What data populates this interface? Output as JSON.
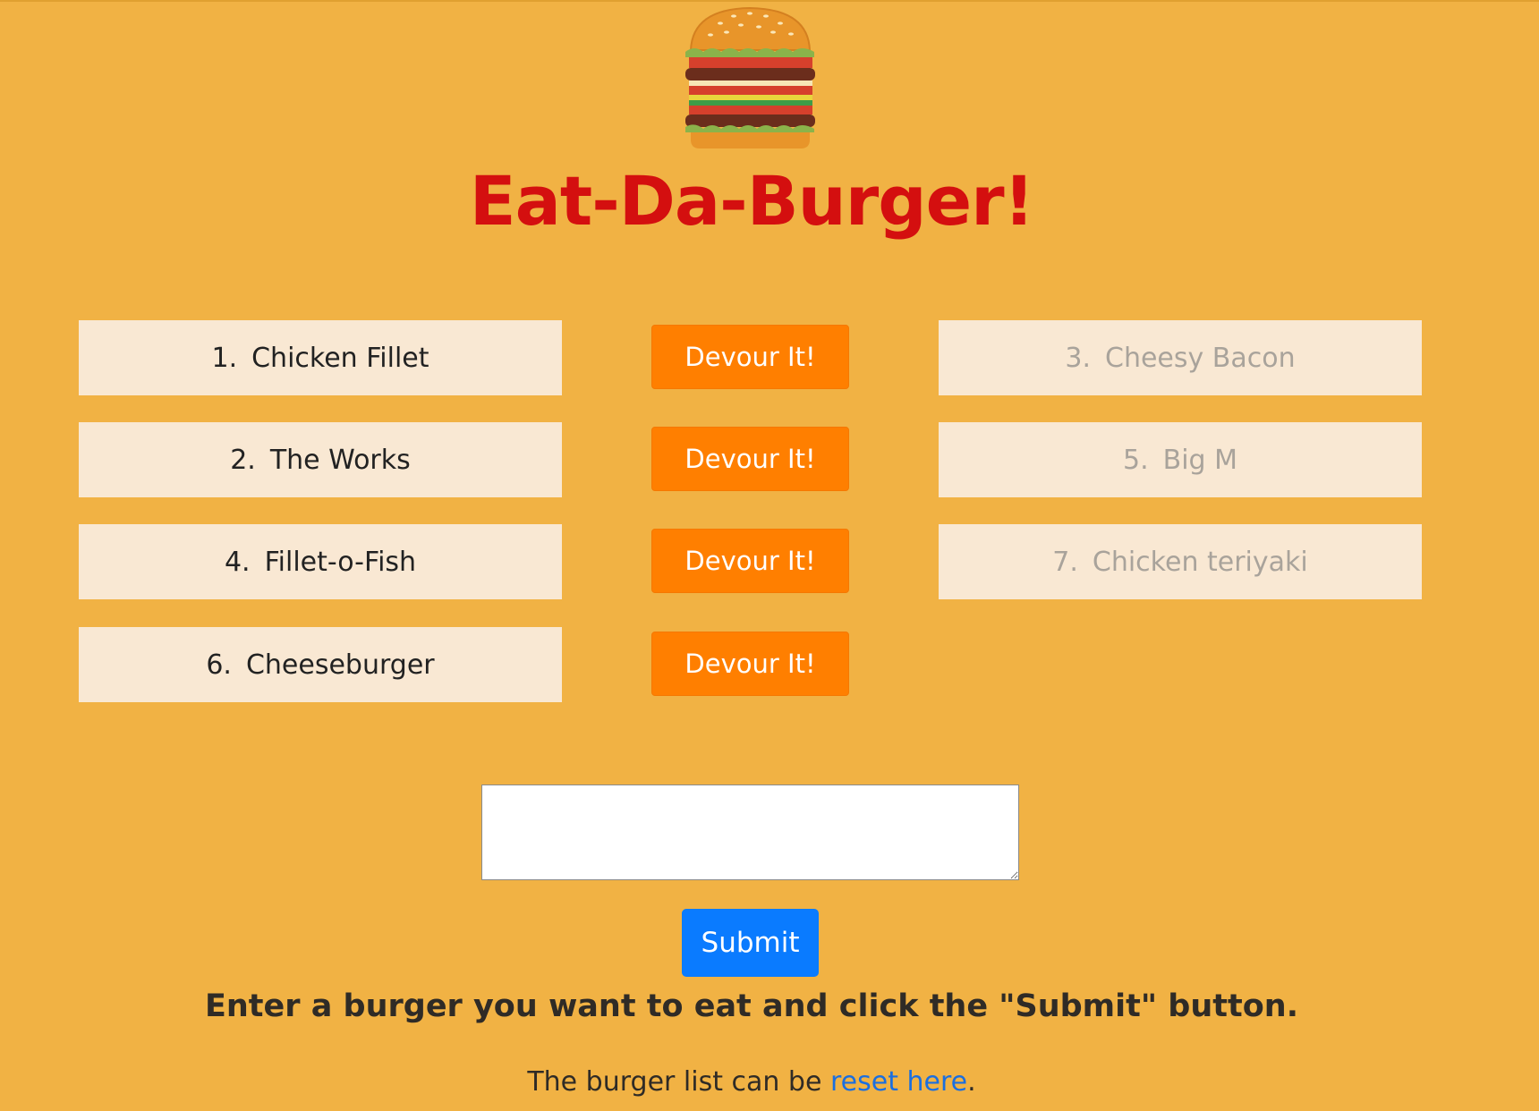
{
  "header": {
    "logo_icon": "burger-icon",
    "title": "Eat-Da-Burger!"
  },
  "colors": {
    "background": "#f1b244",
    "title": "#d40f0f",
    "card": "#f9e8d3",
    "devour_button": "#ff7f00",
    "submit_button": "#0a7bff",
    "link": "#1b6fe0"
  },
  "uneaten": [
    {
      "number": "1.",
      "name": "Chicken Fillet",
      "button_label": "Devour It!"
    },
    {
      "number": "2.",
      "name": "The Works",
      "button_label": "Devour It!"
    },
    {
      "number": "4.",
      "name": "Fillet-o-Fish",
      "button_label": "Devour It!"
    },
    {
      "number": "6.",
      "name": "Cheeseburger",
      "button_label": "Devour It!"
    }
  ],
  "devoured": [
    {
      "number": "3.",
      "name": "Cheesy Bacon"
    },
    {
      "number": "5.",
      "name": "Big M"
    },
    {
      "number": "7.",
      "name": "Chicken teriyaki"
    }
  ],
  "form": {
    "input_value": "",
    "submit_label": "Submit",
    "instruction": "Enter a burger you want to eat and click the \"Submit\" button."
  },
  "footer": {
    "text_before": "The burger list can be ",
    "link_text": "reset here",
    "text_after": "."
  }
}
